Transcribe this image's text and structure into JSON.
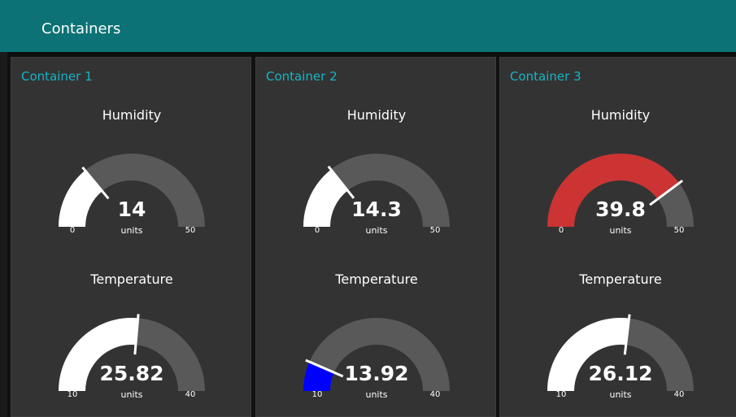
{
  "header": {
    "title": "Containers"
  },
  "colors": {
    "header": "#0c7275",
    "panel": "#333333",
    "panel_title": "#17b4c6",
    "gauge_track": "#595959",
    "gauge_white": "#ffffff",
    "gauge_red": "#cc3333",
    "gauge_blue": "#0000ff"
  },
  "containers": [
    {
      "title": "Container 1",
      "humidity": {
        "label": "Humidity",
        "value": "14",
        "units": "units",
        "min": "0",
        "max": "50",
        "color": "#ffffff"
      },
      "temperature": {
        "label": "Temperature",
        "value": "25.82",
        "units": "units",
        "min": "10",
        "max": "40",
        "color": "#ffffff"
      }
    },
    {
      "title": "Container 2",
      "humidity": {
        "label": "Humidity",
        "value": "14.3",
        "units": "units",
        "min": "0",
        "max": "50",
        "color": "#ffffff"
      },
      "temperature": {
        "label": "Temperature",
        "value": "13.92",
        "units": "units",
        "min": "10",
        "max": "40",
        "color": "#0000ff"
      }
    },
    {
      "title": "Container 3",
      "humidity": {
        "label": "Humidity",
        "value": "39.8",
        "units": "units",
        "min": "0",
        "max": "50",
        "color": "#cc3333"
      },
      "temperature": {
        "label": "Temperature",
        "value": "26.12",
        "units": "units",
        "min": "10",
        "max": "40",
        "color": "#ffffff"
      }
    }
  ]
}
